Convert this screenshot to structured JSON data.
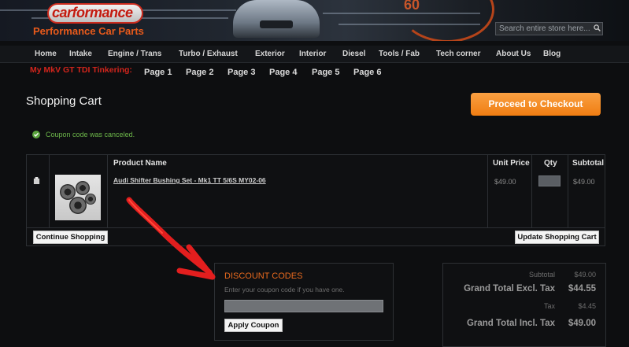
{
  "header": {
    "logo_text": "carformance",
    "tagline": "Performance Car Parts",
    "gauge_number": "60",
    "search_placeholder": "Search entire store here..."
  },
  "nav": {
    "items": [
      "Home",
      "Intake",
      "Engine / Trans",
      "Turbo / Exhaust",
      "Exterior",
      "Interior",
      "Diesel",
      "Tools / Fab",
      "Tech corner",
      "About Us",
      "Blog"
    ]
  },
  "tinkering": {
    "label": "My MkV GT TDI Tinkering:",
    "pages": [
      "Page 1",
      "Page 2",
      "Page 3",
      "Page 4",
      "Page 5",
      "Page 6"
    ]
  },
  "main": {
    "title": "Shopping Cart",
    "checkout_label": "Proceed to Checkout",
    "notice": "Coupon code was canceled."
  },
  "cart": {
    "headers": {
      "product": "Product Name",
      "unit_price": "Unit Price",
      "qty": "Qty",
      "subtotal": "Subtotal"
    },
    "items": [
      {
        "name": "Audi Shifter Bushing Set - Mk1 TT 5/6S MY02-06",
        "unit_price": "$49.00",
        "qty": "1",
        "subtotal": "$49.00"
      }
    ],
    "continue_label": "Continue Shopping",
    "update_label": "Update Shopping Cart"
  },
  "discount": {
    "title": "DISCOUNT CODES",
    "hint": "Enter your coupon code if you have one.",
    "input_value": "",
    "apply_label": "Apply Coupon"
  },
  "totals": {
    "subtotal_label": "Subtotal",
    "subtotal_value": "$49.00",
    "excl_label": "Grand Total Excl. Tax",
    "excl_value": "$44.55",
    "tax_label": "Tax",
    "tax_value": "$4.45",
    "incl_label": "Grand Total Incl. Tax",
    "incl_value": "$49.00"
  },
  "colors": {
    "accent_orange": "#f07d12",
    "brand_red": "#d2251c",
    "success_green": "#6db84a",
    "annotation_red": "#e31e1e"
  }
}
